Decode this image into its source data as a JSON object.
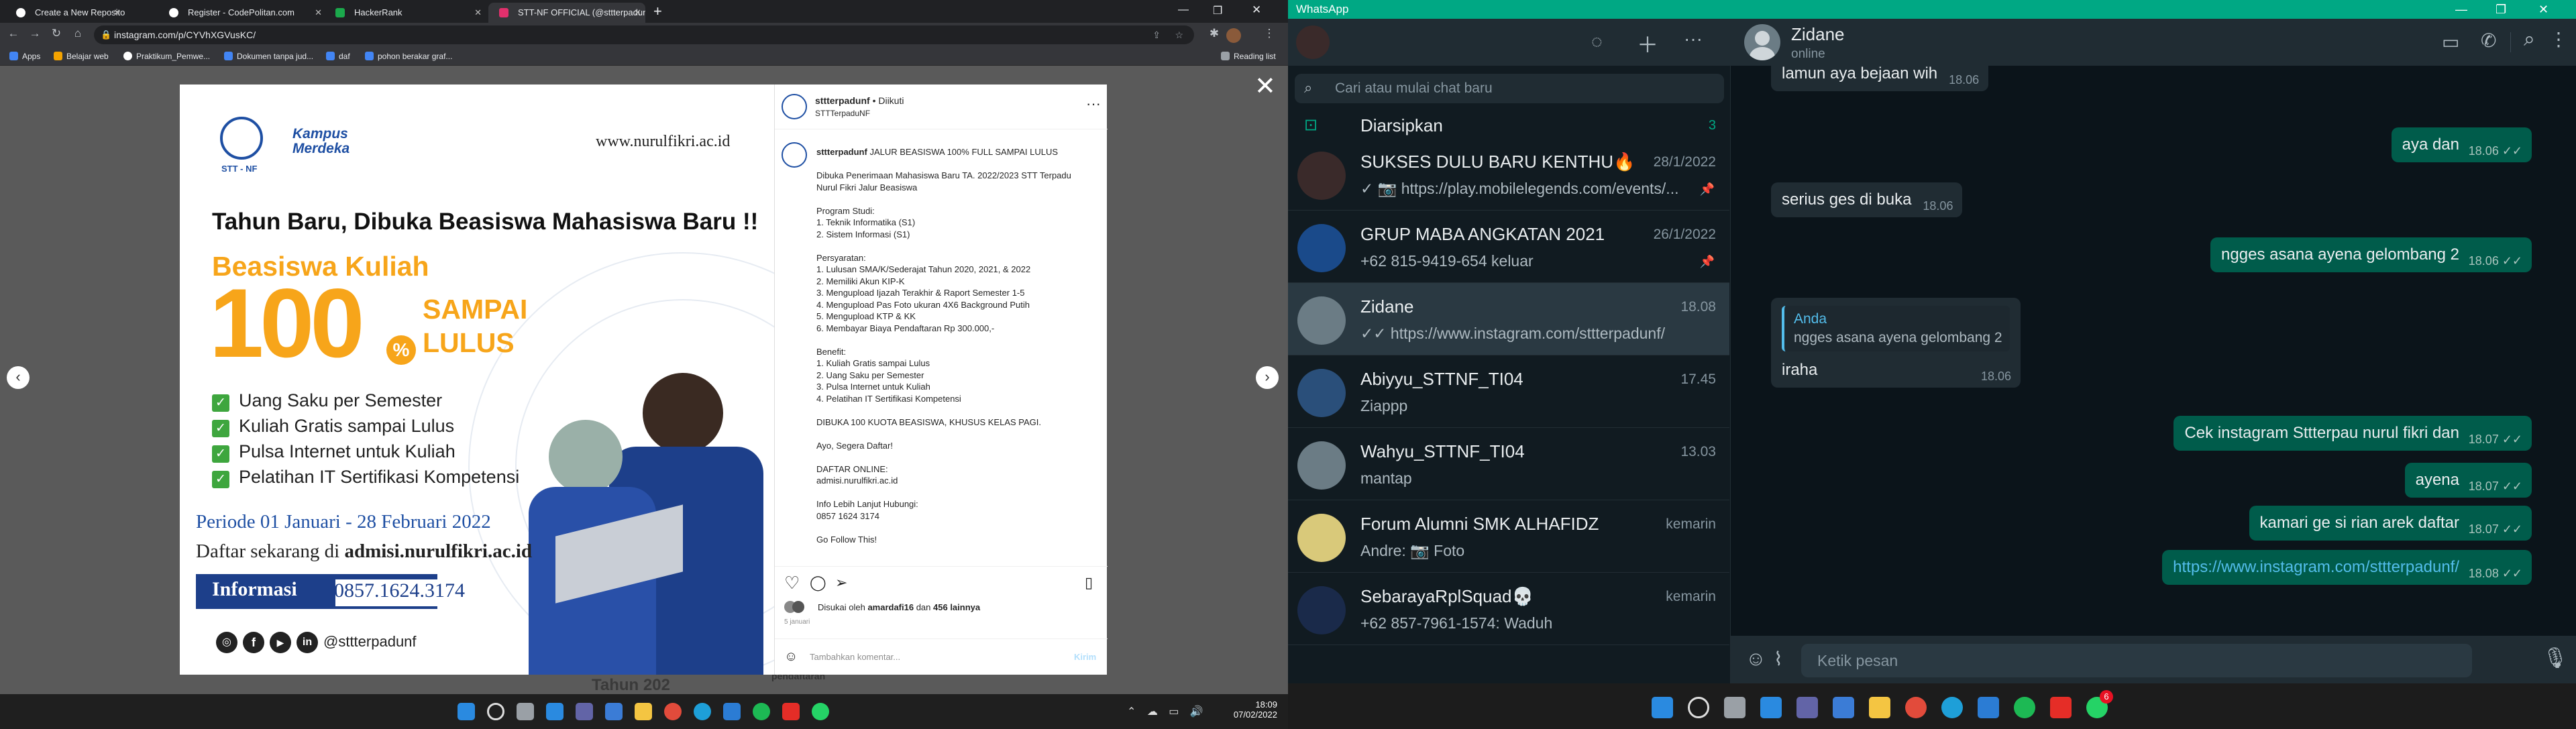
{
  "browser": {
    "tabs": [
      {
        "label": "Create a New Repository",
        "color": "#ffffff"
      },
      {
        "label": "Register - CodePolitan.com",
        "color": "#ffffff"
      },
      {
        "label": "HackerRank",
        "color": "#1ba94c"
      },
      {
        "label": "STT-NF OFFICIAL (@sttterpadun...",
        "color": "#e1306c"
      }
    ],
    "new_tab": "+",
    "url": "instagram.com/p/CYVhXGVusKC/",
    "bookmarks": [
      {
        "label": "Apps",
        "color": "#4285f4"
      },
      {
        "label": "Belajar web",
        "color": "#f4a300"
      },
      {
        "label": "Praktikum_Pemwe...",
        "color": "#ffffff"
      },
      {
        "label": "Dokumen tanpa jud...",
        "color": "#4285f4"
      },
      {
        "label": "daf",
        "color": "#4285f4"
      },
      {
        "label": "pohon berakar graf...",
        "color": "#4285f4"
      }
    ],
    "reading_list": "Reading list"
  },
  "overlay_bg": {
    "text1": "Tahun 202",
    "text2": "pendaftaran"
  },
  "post": {
    "poster": {
      "logo_text": "STT - NF",
      "kampus": "Kampus",
      "merdeka": "Merdeka",
      "website": "www.nurulfikri.ac.id",
      "headline": "Tahun Baru, Dibuka Beasiswa Mahasiswa Baru !!",
      "beasiswa": "Beasiswa Kuliah",
      "hundred": "100",
      "percent": "%",
      "sampai": "SAMPAI",
      "lulus": "LULUS",
      "benefits": [
        "Uang Saku per Semester",
        "Kuliah Gratis sampai Lulus",
        "Pulsa Internet untuk Kuliah",
        "Pelatihan IT Sertifikasi Kompetensi"
      ],
      "periode": "Periode 01 Januari - 28 Februari 2022",
      "daftar_prefix": "Daftar sekarang di ",
      "daftar_site": "admisi.nurulfikri.ac.id",
      "info_label": "Informasi",
      "phone": "0857.1624.3174",
      "handle": "@sttterpadunf"
    },
    "account": "sttterpadunf",
    "follow_state": "• Diikuti",
    "location": "STTTerpaduNF",
    "caption_user": "sttterpadunf",
    "caption_lines": [
      "JALUR BEASISWA 100% FULL SAMPAI LULUS",
      "",
      "Dibuka Penerimaan Mahasiswa Baru TA. 2022/2023 STT Terpadu",
      "Nurul Fikri Jalur Beasiswa",
      "",
      "Program Studi:",
      "1. Teknik Informatika (S1)",
      "2. Sistem Informasi (S1)",
      "",
      "Persyaratan:",
      "1. Lulusan SMA/K/Sederajat Tahun 2020, 2021, & 2022",
      "2. Memiliki Akun KIP-K",
      "3. Mengupload Ijazah Terakhir & Raport Semester 1-5",
      "4. Mengupload Pas Foto ukuran 4X6 Background Putih",
      "5. Mengupload KTP & KK",
      "6. Membayar Biaya Pendaftaran Rp 300.000,-",
      "",
      "Benefit:",
      "1. Kuliah Gratis sampai Lulus",
      "2. Uang Saku per Semester",
      "3. Pulsa Internet untuk Kuliah",
      "4. Pelatihan IT Sertifikasi Kompetensi",
      "",
      "DIBUKA 100 KUOTA BEASISWA, KHUSUS KELAS PAGI.",
      "",
      "Ayo, Segera Daftar!",
      "",
      "DAFTAR ONLINE:",
      "admisi.nurulfikri.ac.id",
      "",
      "Info Lebih Lanjut Hubungi:",
      "0857 1624 3174",
      "",
      "Go Follow This!"
    ],
    "liked_prefix": "Disukai oleh ",
    "liked_user": "amardafi16",
    "liked_mid": " dan ",
    "liked_count": "456 lainnya",
    "time_ago": "5 januari",
    "comment_placeholder": "Tambahkan komentar...",
    "post_button": "Kirim"
  },
  "taskbar_left": {
    "time": "18:09",
    "date": "07/02/2022"
  },
  "whatsapp": {
    "app_title": "WhatsApp",
    "search_placeholder": "Cari atau mulai chat baru",
    "archived_label": "Diarsipkan",
    "archived_count": "3",
    "chats": [
      {
        "name": "SUKSES DULU BARU KENTHU🔥",
        "preview": "✓ 📷 https://play.mobilelegends.com/events/...",
        "time": "28/1/2022",
        "avatar_color": "#3a2a2a",
        "pinned": true
      },
      {
        "name": "GRUP MABA ANGKATAN 2021",
        "preview": "+62 815-9419-654 keluar",
        "time": "26/1/2022",
        "avatar_color": "#1a4a8a",
        "pinned": true
      },
      {
        "name": "Zidane",
        "preview": "✓✓ https://www.instagram.com/sttterpadunf/",
        "time": "18.08",
        "avatar_color": "#6b7c85",
        "pinned": false
      },
      {
        "name": "Abiyyu_STTNF_TI04",
        "preview": "Ziappp",
        "time": "17.45",
        "avatar_color": "#2a4f7a",
        "pinned": false
      },
      {
        "name": "Wahyu_STTNF_TI04",
        "preview": "mantap",
        "time": "13.03",
        "avatar_color": "#6b7c85",
        "pinned": false
      },
      {
        "name": "Forum Alumni SMK ALHAFIDZ",
        "preview": "Andre: 📷 Foto",
        "time": "kemarin",
        "avatar_color": "#d9c97a",
        "pinned": false
      },
      {
        "name": "SebarayaRplSquad💀",
        "preview": "+62 857-7961-1574: Waduh",
        "time": "kemarin",
        "avatar_color": "#1a2a4a",
        "pinned": false
      }
    ],
    "contact_name": "Zidane",
    "contact_status": "online",
    "messages": [
      {
        "text": "lamun aya bejaan wih",
        "time": "18.06",
        "dir": "in"
      },
      {
        "text": "aya dan",
        "time": "18.06",
        "dir": "out"
      },
      {
        "text": "serius ges di buka",
        "time": "18.06",
        "dir": "in"
      },
      {
        "text": "ngges asana ayena gelombang 2",
        "time": "18.06",
        "dir": "out"
      },
      {
        "quote_author": "Anda",
        "quote": "ngges asana ayena gelombang 2",
        "text": "iraha",
        "time": "18.06",
        "dir": "in"
      },
      {
        "text": "Cek instagram Sttterpau nurul fikri dan",
        "time": "18.07",
        "dir": "out"
      },
      {
        "text": "ayena",
        "time": "18.07",
        "dir": "out"
      },
      {
        "text": "kamari ge si rian arek daftar",
        "time": "18.07",
        "dir": "out"
      },
      {
        "text": "https://www.instagram.com/sttterpadunf/",
        "time": "18.08",
        "dir": "out"
      }
    ],
    "input_placeholder": "Ketik pesan",
    "colors": {
      "accent": "#00a884",
      "bubble_out": "#005c4b",
      "bubble_in": "#202c33",
      "link": "#53bdeb"
    }
  },
  "taskbar_right": {
    "whatsapp_badge": "6"
  }
}
